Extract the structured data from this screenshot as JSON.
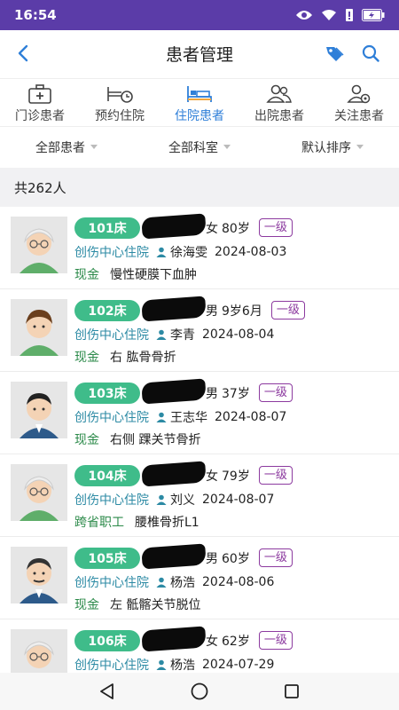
{
  "status_bar": {
    "time": "16:54",
    "icons": [
      "eye-icon",
      "wifi-icon",
      "alert-icon",
      "battery-charging-icon"
    ]
  },
  "header": {
    "back_icon": "chevron-left-icon",
    "title": "患者管理",
    "tag_icon": "tag-icon",
    "search_icon": "search-icon"
  },
  "tabs": [
    {
      "label": "门诊患者",
      "icon": "medical-kit-icon",
      "active": false
    },
    {
      "label": "预约住院",
      "icon": "bed-clock-icon",
      "active": false
    },
    {
      "label": "住院患者",
      "icon": "hospital-bed-icon",
      "active": true
    },
    {
      "label": "出院患者",
      "icon": "people-icon",
      "active": false
    },
    {
      "label": "关注患者",
      "icon": "person-gear-icon",
      "active": false
    }
  ],
  "filters": [
    {
      "label": "全部患者"
    },
    {
      "label": "全部科室"
    },
    {
      "label": "默认排序"
    }
  ],
  "count_text": "共262人",
  "accent_colors": {
    "status_bar": "#5b3ca8",
    "active_tab": "#2f7fd8",
    "bed_badge": "#3fbc8a",
    "level_badge": "#8c3a9f",
    "department": "#2c8aa4",
    "payment": "#2c8a4a"
  },
  "patients": [
    {
      "bed": "101床",
      "gender": "女",
      "age": "80岁",
      "level": "一级",
      "department": "创伤中心住院",
      "doctor": "徐海雯",
      "date": "2024-08-03",
      "payment": "现金",
      "diagnosis": "慢性硬膜下血肿",
      "avatar": "elderly-woman-avatar"
    },
    {
      "bed": "102床",
      "gender": "男",
      "age": "9岁6月",
      "level": "一级",
      "department": "创伤中心住院",
      "doctor": "李青",
      "date": "2024-08-04",
      "payment": "现金",
      "diagnosis": "右 肱骨骨折",
      "avatar": "boy-avatar"
    },
    {
      "bed": "103床",
      "gender": "男",
      "age": "37岁",
      "level": "一级",
      "department": "创伤中心住院",
      "doctor": "王志华",
      "date": "2024-08-07",
      "payment": "现金",
      "diagnosis": "右侧 踝关节骨折",
      "avatar": "man-avatar"
    },
    {
      "bed": "104床",
      "gender": "女",
      "age": "79岁",
      "level": "一级",
      "department": "创伤中心住院",
      "doctor": "刘义",
      "date": "2024-08-07",
      "payment": "跨省职工",
      "diagnosis": "腰椎骨折L1",
      "avatar": "elderly-woman-avatar"
    },
    {
      "bed": "105床",
      "gender": "男",
      "age": "60岁",
      "level": "一级",
      "department": "创伤中心住院",
      "doctor": "杨浩",
      "date": "2024-08-06",
      "payment": "现金",
      "diagnosis": "左 骶髂关节脱位",
      "avatar": "older-man-avatar"
    },
    {
      "bed": "106床",
      "gender": "女",
      "age": "62岁",
      "level": "一级",
      "department": "创伤中心住院",
      "doctor": "杨浩",
      "date": "2024-07-29",
      "payment": "",
      "diagnosis": "",
      "avatar": "elderly-woman-avatar"
    }
  ],
  "nav_bar": {
    "back_icon": "triangle-back-icon",
    "home_icon": "circle-home-icon",
    "recents_icon": "square-recents-icon"
  }
}
